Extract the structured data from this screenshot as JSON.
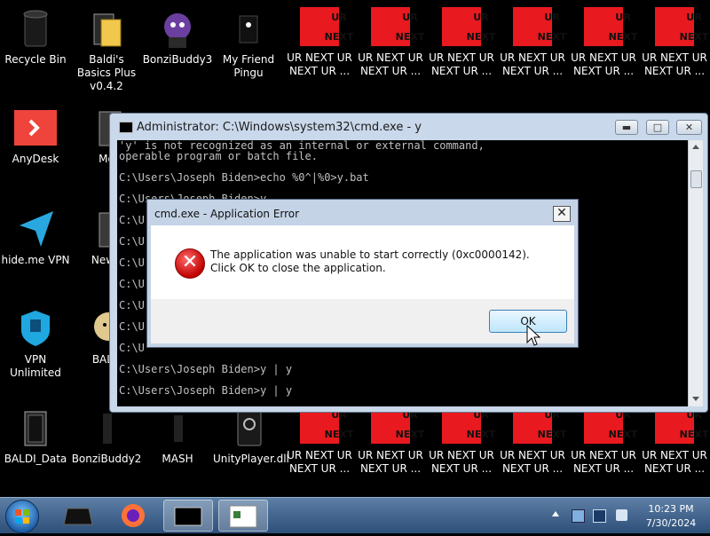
{
  "desktop": {
    "icons_top": [
      {
        "label": "Recycle Bin"
      },
      {
        "label": "Baldi's Basics Plus v0.4.2"
      },
      {
        "label": "BonziBuddy3"
      },
      {
        "label": "My Friend Pingu"
      }
    ],
    "icons_left": [
      {
        "label": "AnyDesk"
      },
      {
        "label": "hide.me VPN"
      },
      {
        "label": "VPN Unlimited"
      },
      {
        "label": "BALDI_Data"
      }
    ],
    "partial_icons": [
      {
        "label": "Mo"
      },
      {
        "label": "New f"
      },
      {
        "label": "BALD"
      }
    ],
    "icons_bottom": [
      {
        "label": "BonziBuddy2"
      },
      {
        "label": "MASH"
      },
      {
        "label": "UnityPlayer.dll"
      }
    ],
    "ur_tile": {
      "top_text": "UR",
      "bottom_text": "NEXT",
      "label": "UR NEXT UR NEXT UR ..."
    }
  },
  "console": {
    "title": "Administrator: C:\\Windows\\system32\\cmd.exe - y",
    "lines": [
      "'y' is not recognized as an internal or external command,",
      "operable program or batch file.",
      "",
      "C:\\Users\\Joseph Biden>echo %0^|%0>y.bat",
      "",
      "C:\\Users\\Joseph Biden>y",
      "",
      "C:\\U",
      "",
      "C:\\U",
      "",
      "C:\\U",
      "",
      "C:\\U",
      "",
      "C:\\U",
      "",
      "C:\\U",
      "",
      "C:\\U",
      "",
      "C:\\Users\\Joseph Biden>y | y",
      "",
      "C:\\Users\\Joseph Biden>y | y"
    ],
    "minimize_glyph": "▬",
    "maximize_glyph": "□",
    "close_glyph": "✕"
  },
  "dialog": {
    "title": "cmd.exe - Application Error",
    "message": "The application was unable to start correctly (0xc0000142). Click OK to close the application.",
    "ok_label": "OK",
    "close_glyph": "✕",
    "error_glyph": "✕"
  },
  "taskbar": {
    "time": "10:23 PM",
    "date": "7/30/2024"
  },
  "colors": {
    "ur_red": "#e8191f",
    "console_bg": "#000000",
    "console_text": "#c0c0c0"
  }
}
